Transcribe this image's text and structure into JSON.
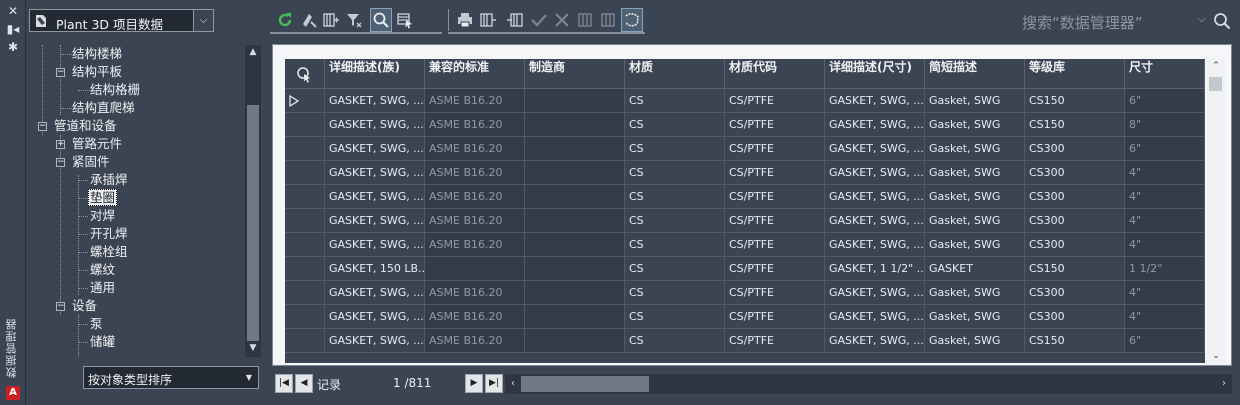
{
  "palette": {
    "title": "数据管理器",
    "logo": "A"
  },
  "project": {
    "label": "Plant 3D 项目数据"
  },
  "tree": {
    "items": [
      {
        "label": "结构楼梯"
      },
      {
        "label": "结构平板"
      },
      {
        "label": "结构格栅"
      },
      {
        "label": "结构直爬梯"
      },
      {
        "label": "管道和设备"
      },
      {
        "label": "管路元件"
      },
      {
        "label": "紧固件"
      },
      {
        "label": "承插焊"
      },
      {
        "label": "垫圈"
      },
      {
        "label": "对焊"
      },
      {
        "label": "开孔焊"
      },
      {
        "label": "螺栓组"
      },
      {
        "label": "螺纹"
      },
      {
        "label": "通用"
      },
      {
        "label": "设备"
      },
      {
        "label": "泵"
      },
      {
        "label": "储罐"
      }
    ]
  },
  "sort": {
    "label": "按对象类型排序"
  },
  "search": {
    "placeholder": "搜索“数据管理器”"
  },
  "grid": {
    "columns": [
      "详细描述(族)",
      "兼容的标准",
      "制造商",
      "材质",
      "材质代码",
      "详细描述(尺寸)",
      "简短描述",
      "等级库",
      "尺寸"
    ],
    "rows": [
      [
        "GASKET, SWG, ...",
        "ASME B16.20",
        "",
        "CS",
        "CS/PTFE",
        "GASKET, SWG, ...",
        "Gasket, SWG",
        "CS150",
        "6\""
      ],
      [
        "GASKET, SWG, ...",
        "ASME B16.20",
        "",
        "CS",
        "CS/PTFE",
        "GASKET, SWG, ...",
        "Gasket, SWG",
        "CS150",
        "8\""
      ],
      [
        "GASKET, SWG, ...",
        "ASME B16.20",
        "",
        "CS",
        "CS/PTFE",
        "GASKET, SWG, ...",
        "Gasket, SWG",
        "CS300",
        "6\""
      ],
      [
        "GASKET, SWG, ...",
        "ASME B16.20",
        "",
        "CS",
        "CS/PTFE",
        "GASKET, SWG, ...",
        "Gasket, SWG",
        "CS300",
        "4\""
      ],
      [
        "GASKET, SWG, ...",
        "ASME B16.20",
        "",
        "CS",
        "CS/PTFE",
        "GASKET, SWG, ...",
        "Gasket, SWG",
        "CS300",
        "4\""
      ],
      [
        "GASKET, SWG, ...",
        "ASME B16.20",
        "",
        "CS",
        "CS/PTFE",
        "GASKET, SWG, ...",
        "Gasket, SWG",
        "CS300",
        "4\""
      ],
      [
        "GASKET, SWG, ...",
        "ASME B16.20",
        "",
        "CS",
        "CS/PTFE",
        "GASKET, SWG, ...",
        "Gasket, SWG",
        "CS300",
        "4\""
      ],
      [
        "GASKET, 150 LB...",
        "",
        "",
        "CS",
        "CS/PTFE",
        "GASKET, 1 1/2\" ...",
        "GASKET",
        "CS150",
        "1 1/2\""
      ],
      [
        "GASKET, SWG, ...",
        "ASME B16.20",
        "",
        "CS",
        "CS/PTFE",
        "GASKET, SWG, ...",
        "Gasket, SWG",
        "CS300",
        "4\""
      ],
      [
        "GASKET, SWG, ...",
        "ASME B16.20",
        "",
        "CS",
        "CS/PTFE",
        "GASKET, SWG, ...",
        "Gasket, SWG",
        "CS300",
        "4\""
      ],
      [
        "GASKET, SWG, ...",
        "ASME B16.20",
        "",
        "CS",
        "CS/PTFE",
        "GASKET, SWG, ...",
        "Gasket, SWG",
        "CS150",
        "6\""
      ]
    ]
  },
  "nav": {
    "record_label": "记录",
    "position": "1 /811"
  },
  "colors": {
    "background": "#3b4453",
    "grid_border": "#f5f6f8",
    "readonly_cell": "#343c48",
    "refresh_icon": "#3fbf5a",
    "selection_highlight": "#506073"
  }
}
